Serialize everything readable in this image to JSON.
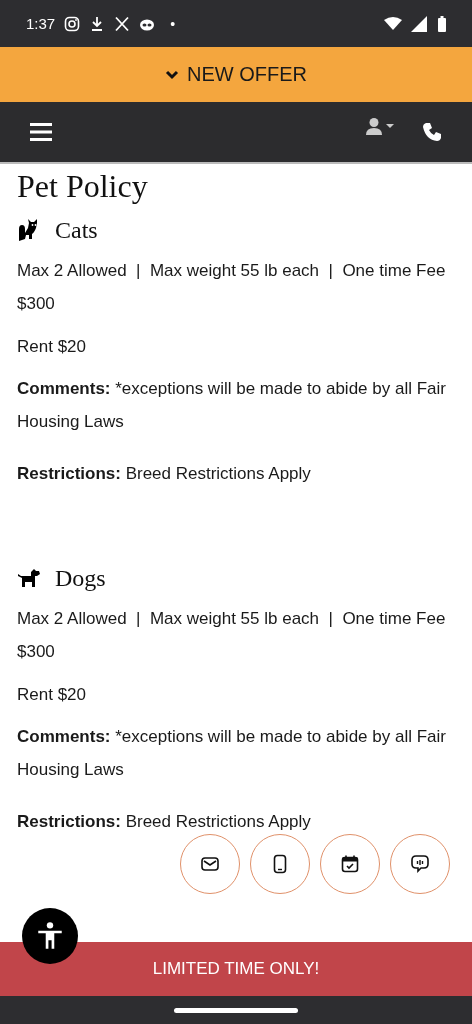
{
  "status_bar": {
    "time": "1:37",
    "dot": "•"
  },
  "offer_banner": {
    "label": "NEW OFFER"
  },
  "page_title": "Pet Policy",
  "sections": [
    {
      "kind": "cat",
      "title": "Cats",
      "details": "Max 2 Allowed  |  Max weight 55 lb each  |  One time Fee $300",
      "rent": "Rent $20",
      "comments": {
        "label": "Comments:",
        "text": "*exceptions will be made to abide by all Fair Housing Laws"
      },
      "restrictions": {
        "label": "Restrictions:",
        "text": "Breed Restrictions Apply"
      }
    },
    {
      "kind": "dog",
      "title": "Dogs",
      "details": "Max 2 Allowed  |  Max weight 55 lb each  |  One time Fee $300",
      "rent": "Rent $20",
      "comments": {
        "label": "Comments:",
        "text": "*exceptions will be made to abide by all Fair Housing Laws"
      },
      "restrictions": {
        "label": "Restrictions:",
        "text": "Breed Restrictions Apply"
      }
    }
  ],
  "contact_buttons": [
    {
      "kind": "email"
    },
    {
      "kind": "phone"
    },
    {
      "kind": "calendar"
    },
    {
      "kind": "chat"
    }
  ],
  "promo_bar": {
    "label": "LIMITED TIME ONLY!"
  }
}
